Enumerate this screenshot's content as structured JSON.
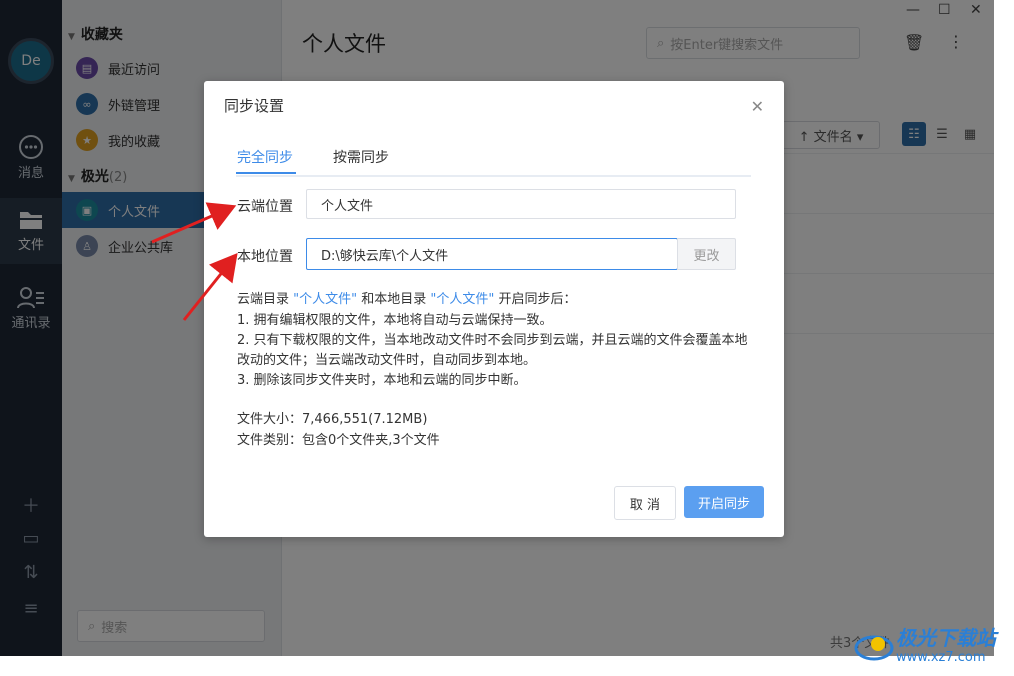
{
  "window": {
    "minimize": "—",
    "maximize": "☐",
    "close": "✕"
  },
  "rail": {
    "avatar": "De",
    "items": [
      {
        "label": "消息"
      },
      {
        "label": "文件"
      },
      {
        "label": "通讯录"
      }
    ]
  },
  "sidebar": {
    "favorites_title": "收藏夹",
    "favorites": [
      {
        "label": "最近访问"
      },
      {
        "label": "外链管理"
      },
      {
        "label": "我的收藏"
      }
    ],
    "group_title": "极光",
    "group_count": "(2)",
    "group_items": [
      {
        "label": "个人文件"
      },
      {
        "label": "企业公共库"
      }
    ],
    "search_placeholder": "搜索"
  },
  "main": {
    "title": "个人文件",
    "search_placeholder": "按Enter键搜索文件",
    "sort_label": "↑ 文件名 ▾",
    "footer_count": "共3个文件"
  },
  "dialog": {
    "title": "同步设置",
    "tabs": [
      {
        "label": "完全同步"
      },
      {
        "label": "按需同步"
      }
    ],
    "cloud_label": "云端位置",
    "cloud_value": "个人文件",
    "local_label": "本地位置",
    "local_value": "D:\\够快云库\\个人文件",
    "change_button": "更改",
    "desc_line1_a": "云端目录 ",
    "desc_line1_q1": "\"个人文件\"",
    "desc_line1_b": " 和本地目录 ",
    "desc_line1_q2": "\"个人文件\"",
    "desc_line1_c": " 开启同步后：",
    "desc_line2": "1. 拥有编辑权限的文件，本地将自动与云端保持一致。",
    "desc_line3": "2. 只有下载权限的文件，当本地改动文件时不会同步到云端，并且云端的文件会覆盖本地改动的文件；当云端改动文件时，自动同步到本地。",
    "desc_line4": "3. 删除该同步文件夹时，本地和云端的同步中断。",
    "size_line": "文件大小：7,466,551(7.12MB)",
    "type_line": "文件类别：包含0个文件夹,3个文件",
    "cancel_button": "取 消",
    "start_button": "开启同步"
  },
  "watermark": {
    "line1": "极光下载站",
    "line2": "www.xz7.com"
  },
  "colors": {
    "accent": "#3d8be8",
    "rail": "#1f2937",
    "annotation_arrow": "#e02020"
  }
}
